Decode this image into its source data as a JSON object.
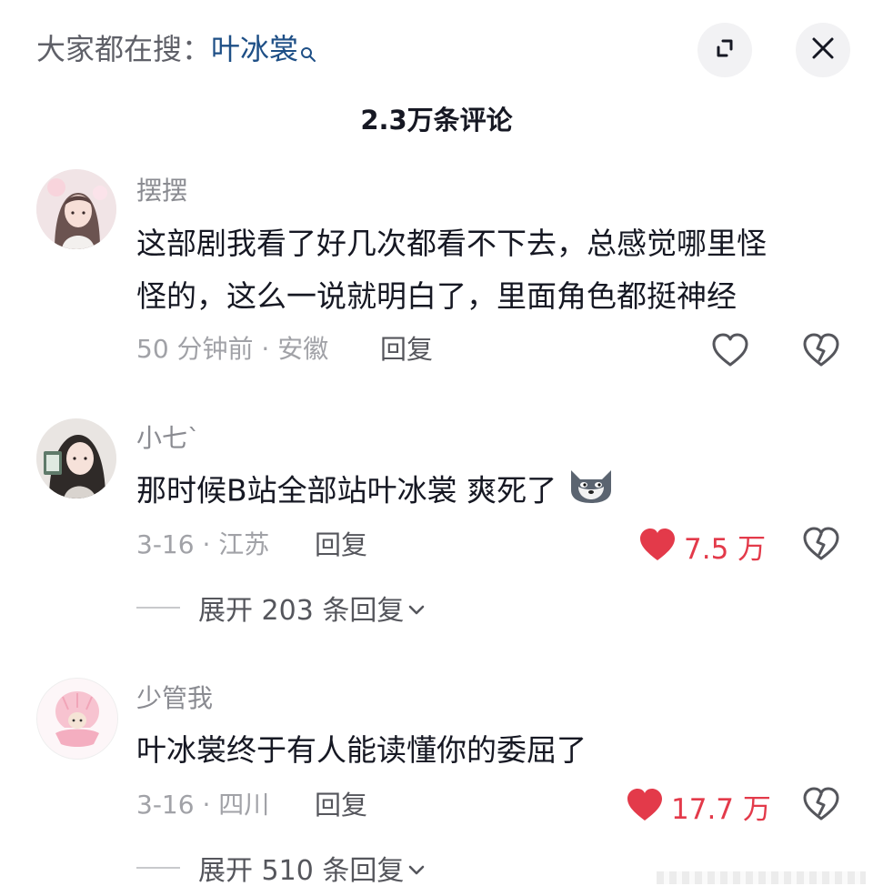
{
  "header": {
    "search_prefix": "大家都在搜：",
    "search_keyword": "叶冰裳",
    "comment_count_title": "2.3万条评论"
  },
  "comments": [
    {
      "username": "摆摆",
      "content_line1": "这部剧我看了好几次都看不下去，总感觉哪里怪",
      "content_line2": "怪的，这么一说就明白了，里面角色都挺神经",
      "meta": "50 分钟前 · 安徽",
      "reply_label": "回复",
      "liked": false,
      "like_count": ""
    },
    {
      "username": "小七`",
      "content": "那时候B站全部站叶冰裳 爽死了",
      "meta": "3-16 · 江苏",
      "reply_label": "回复",
      "liked": true,
      "like_count": "7.5 万",
      "expand_label": "展开 203 条回复"
    },
    {
      "username": "少管我",
      "content": "叶冰裳终于有人能读懂你的委屈了",
      "meta": "3-16 · 四川",
      "reply_label": "回复",
      "liked": true,
      "like_count": "17.7 万",
      "expand_label": "展开 510 条回复"
    }
  ],
  "colors": {
    "keyword": "#1e4f86",
    "like_red": "#e33a4a",
    "meta_gray": "#a1a2a7"
  },
  "icons": [
    "search-icon",
    "expand-icon",
    "close-icon",
    "heart-outline-icon",
    "heart-filled-icon",
    "broken-heart-icon",
    "chevron-down-icon",
    "emoji-icon"
  ]
}
